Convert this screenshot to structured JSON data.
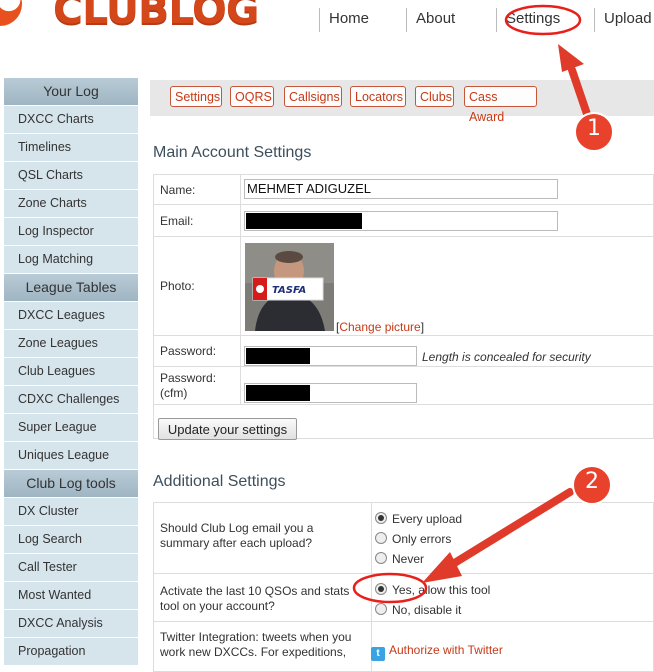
{
  "brand": {
    "name": "CLUBLOG"
  },
  "top_nav": {
    "home": "Home",
    "about": "About",
    "settings": "Settings",
    "upload": "Upload"
  },
  "sidebar": {
    "sections": [
      {
        "title": "Your Log",
        "items": [
          "DXCC Charts",
          "Timelines",
          "QSL Charts",
          "Zone Charts",
          "Log Inspector",
          "Log Matching"
        ]
      },
      {
        "title": "League Tables",
        "items": [
          "DXCC Leagues",
          "Zone Leagues",
          "Club Leagues",
          "CDXC Challenges",
          "Super League",
          "Uniques League"
        ]
      },
      {
        "title": "Club Log tools",
        "items": [
          "DX Cluster",
          "Log Search",
          "Call Tester",
          "Most Wanted",
          "DXCC Analysis",
          "Propagation"
        ]
      }
    ]
  },
  "tabs": [
    "Settings",
    "OQRS",
    "Callsigns",
    "Locators",
    "Clubs",
    "Cass Award"
  ],
  "main": {
    "title": "Main Account Settings",
    "name_label": "Name:",
    "name_value": "MEHMET ADIGUZEL",
    "email_label": "Email:",
    "photo_label": "Photo:",
    "photo_sign_text": "TASFA",
    "change_picture_open": "[",
    "change_picture_link": "Change picture",
    "change_picture_close": "]",
    "password_label": "Password:",
    "password_note": "Length is concealed for security",
    "password_cfm_label": "Password: (cfm)",
    "update_button": "Update your settings"
  },
  "additional": {
    "title": "Additional Settings",
    "q1": "Should Club Log email you a summary after each upload?",
    "q1_options": [
      "Every upload",
      "Only errors",
      "Never"
    ],
    "q1_selected": 0,
    "q2": "Activate the last 10 QSOs and stats tool on your account?",
    "q2_options": [
      "Yes, allow this tool",
      "No, disable it"
    ],
    "q2_selected": 0,
    "q3": "Twitter Integration: tweets when you work new DXCCs. For expeditions,",
    "twitter_link": "Authorize with Twitter"
  },
  "annotations": {
    "marker1": "1",
    "marker2": "2"
  },
  "colors": {
    "accent": "#c63a17",
    "annotation": "#e8201b",
    "sidebar_head": "#a9bfcb",
    "sidebar_item": "#d6e4ec"
  }
}
